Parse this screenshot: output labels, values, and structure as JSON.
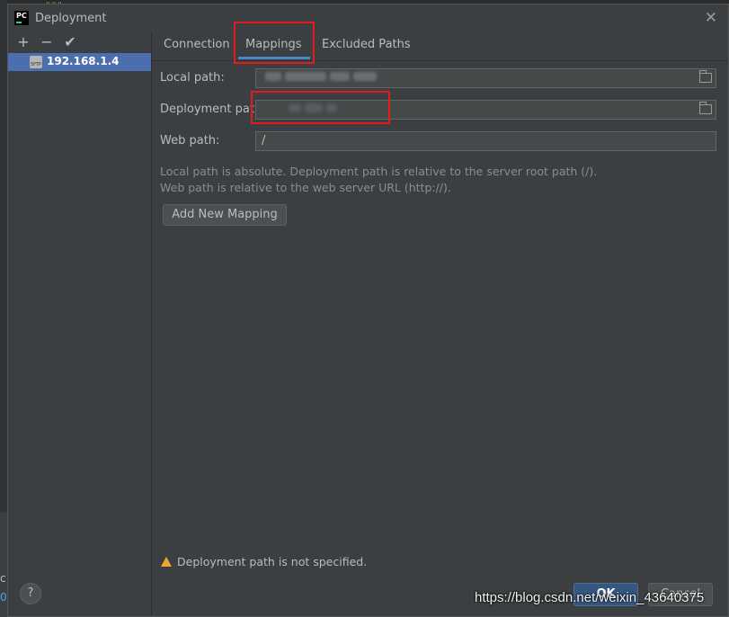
{
  "window": {
    "title": "Deployment",
    "close": "✕",
    "app_icon_text": "PC"
  },
  "toolbar": {
    "add": "+",
    "remove": "−",
    "apply": "✔"
  },
  "servers": [
    {
      "label": "192.168.1.4",
      "icon": "sftp-icon",
      "selected": true
    }
  ],
  "tabs": [
    {
      "label": "Connection"
    },
    {
      "label": "Mappings",
      "active": true
    },
    {
      "label": "Excluded Paths"
    }
  ],
  "form": {
    "local_path": {
      "label": "Local path:",
      "value": ""
    },
    "deployment_path": {
      "label": "Deployment path",
      "value": ""
    },
    "web_path": {
      "label": "Web path:",
      "value": "/"
    }
  },
  "help_lines": [
    "Local path is absolute. Deployment path is relative to the server root path (/).",
    "Web path is relative to the web server URL (http://)."
  ],
  "buttons": {
    "add_mapping": "Add New Mapping",
    "ok": "OK",
    "cancel": "Cancel",
    "help": "?"
  },
  "warning": {
    "text": "Deployment path is not specified.",
    "icon": "warning-icon"
  },
  "background": {
    "code_fragment": "\"\"\"",
    "frag1": "c",
    "frag2": "0"
  },
  "watermark": "https://blog.csdn.net/weixin_43640375",
  "colors": {
    "selection": "#4b6eaf",
    "accent_tab": "#4a88c7",
    "highlight_box": "#e31b1b",
    "primary_button": "#365880"
  }
}
